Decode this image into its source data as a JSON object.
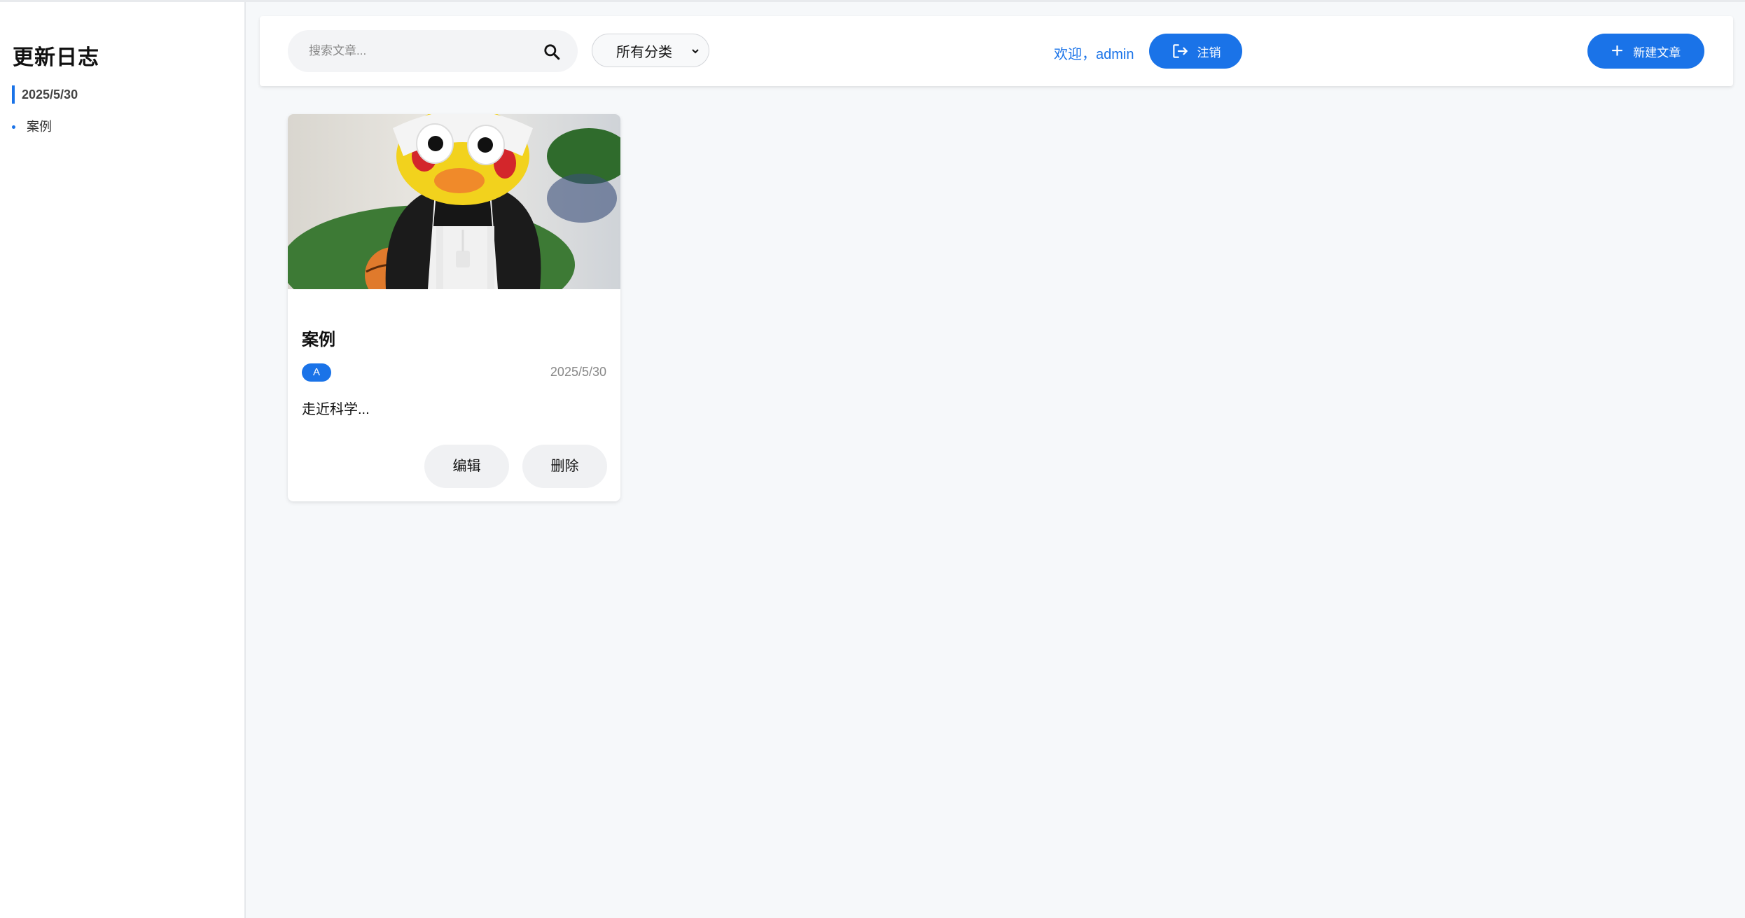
{
  "sidebar": {
    "title": "更新日志",
    "log_date": "2025/5/30",
    "entries": [
      {
        "label": "案例"
      }
    ]
  },
  "header": {
    "search": {
      "placeholder": "搜索文章...",
      "value": ""
    },
    "category_select": {
      "selected": "所有分类"
    },
    "welcome_text": "欢迎，admin",
    "logout_label": "注销",
    "new_article_label": "新建文章"
  },
  "posts": [
    {
      "title": "案例",
      "category_badge": "A",
      "date": "2025/5/30",
      "excerpt": "走近科学...",
      "edit_label": "编辑",
      "delete_label": "删除"
    }
  ],
  "colors": {
    "accent": "#1a73e8",
    "page_background": "#f6f8fa",
    "button_gray": "#f0f1f3"
  },
  "icons": [
    "search-icon",
    "chevron-down-icon",
    "logout-icon",
    "plus-icon"
  ]
}
